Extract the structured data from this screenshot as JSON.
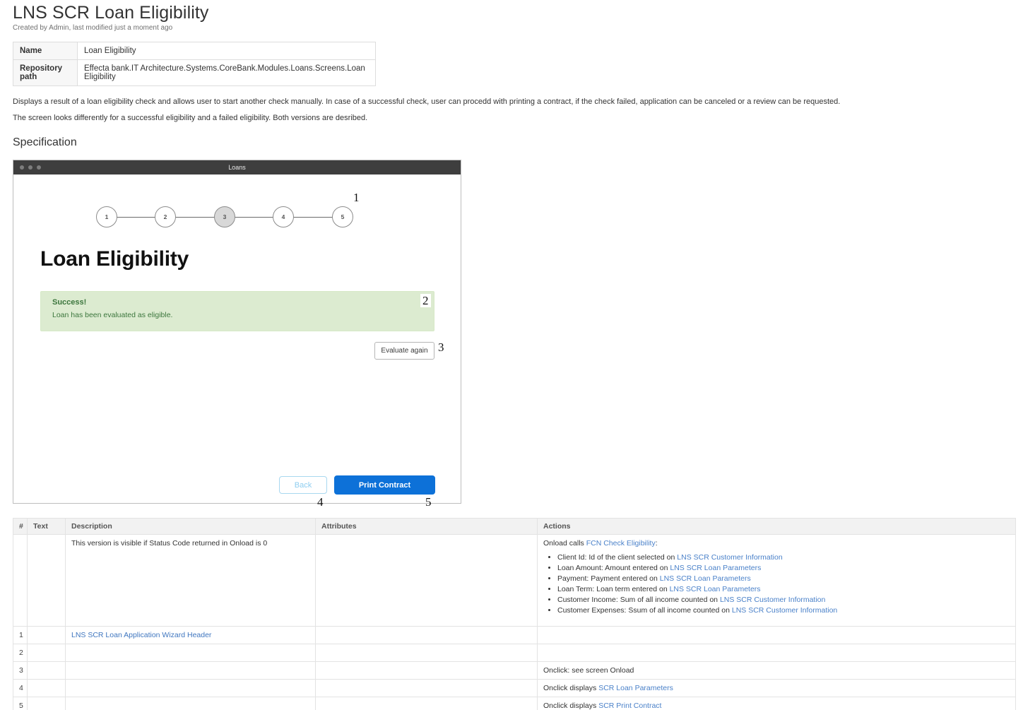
{
  "header": {
    "title": "LNS SCR Loan Eligibility",
    "byline": "Created by Admin, last modified just a moment ago"
  },
  "info_table": {
    "rows": [
      {
        "key": "Name",
        "value": "Loan Eligibility"
      },
      {
        "key": "Repository path",
        "value": "Effecta bank.IT Architecture.Systems.CoreBank.Modules.Loans.Screens.Loan Eligibility"
      }
    ]
  },
  "description": {
    "p1": "Displays a result of a loan eligibility check and allows user to start another check manually. In case of a successful check, user can procedd with printing a contract, if the check failed, application can be canceled or a review can be requested.",
    "p2": "The screen looks differently for a successful eligibility and a failed eligibility. Both versions are desribed."
  },
  "section_heading": "Specification",
  "mockup": {
    "window_title": "Loans",
    "stepper": {
      "steps": [
        "1",
        "2",
        "3",
        "4",
        "5"
      ],
      "active_index": 2
    },
    "screen_title": "Loan Eligibility",
    "alert": {
      "title": "Success!",
      "text": "Loan has been evaluated as eligible.",
      "bg_color": "#dcebd0",
      "text_color": "#3c763d"
    },
    "evaluate_button": "Evaluate again",
    "back_button": "Back",
    "print_button": "Print Contract",
    "primary_color": "#0d71d8",
    "annotations": {
      "a1": "1",
      "a2": "2",
      "a3": "3",
      "a4": "4",
      "a5": "5"
    }
  },
  "spec_table": {
    "columns": [
      "#",
      "Text",
      "Description",
      "Attributes",
      "Actions"
    ],
    "intro_row": {
      "num": "",
      "text": "",
      "description": "This version is visible if  Status Code returned in Onload is 0",
      "attributes": "",
      "actions_lead": "Onload calls ",
      "actions_link": "FCN Check Eligibility",
      "actions_colon": ":",
      "bullets": [
        {
          "lead": "Client Id: Id of the client selected on ",
          "link": "LNS SCR Customer Information"
        },
        {
          "lead": "Loan Amount: Amount entered on ",
          "link": "LNS SCR Loan Parameters"
        },
        {
          "lead": "Payment: Payment entered on ",
          "link": "LNS SCR Loan Parameters"
        },
        {
          "lead": "Loan Term: Loan term entered on ",
          "link": "LNS SCR Loan Parameters"
        },
        {
          "lead": "Customer Income: Sum of all income counted on ",
          "link": "LNS SCR Customer Information"
        },
        {
          "lead": "Customer Expenses: Ssum of all income counted on ",
          "link": "LNS SCR Customer Information"
        }
      ]
    },
    "rows": [
      {
        "num": "1",
        "text": "",
        "desc_link": "LNS SCR Loan Application Wizard Header",
        "desc_plain": "",
        "attributes": "",
        "actions_lead": "",
        "actions_link": ""
      },
      {
        "num": "2",
        "text": "",
        "desc_link": "",
        "desc_plain": "",
        "attributes": "",
        "actions_lead": "",
        "actions_link": ""
      },
      {
        "num": "3",
        "text": "",
        "desc_link": "",
        "desc_plain": "",
        "attributes": "",
        "actions_lead": "Onclick: see screen Onload",
        "actions_link": ""
      },
      {
        "num": "4",
        "text": "",
        "desc_link": "",
        "desc_plain": "",
        "attributes": "",
        "actions_lead": "Onclick displays ",
        "actions_link": "SCR Loan Parameters"
      },
      {
        "num": "5",
        "text": "",
        "desc_link": "",
        "desc_plain": "",
        "attributes": "",
        "actions_lead": "Onclick displays ",
        "actions_link": "SCR Print Contract"
      }
    ]
  }
}
